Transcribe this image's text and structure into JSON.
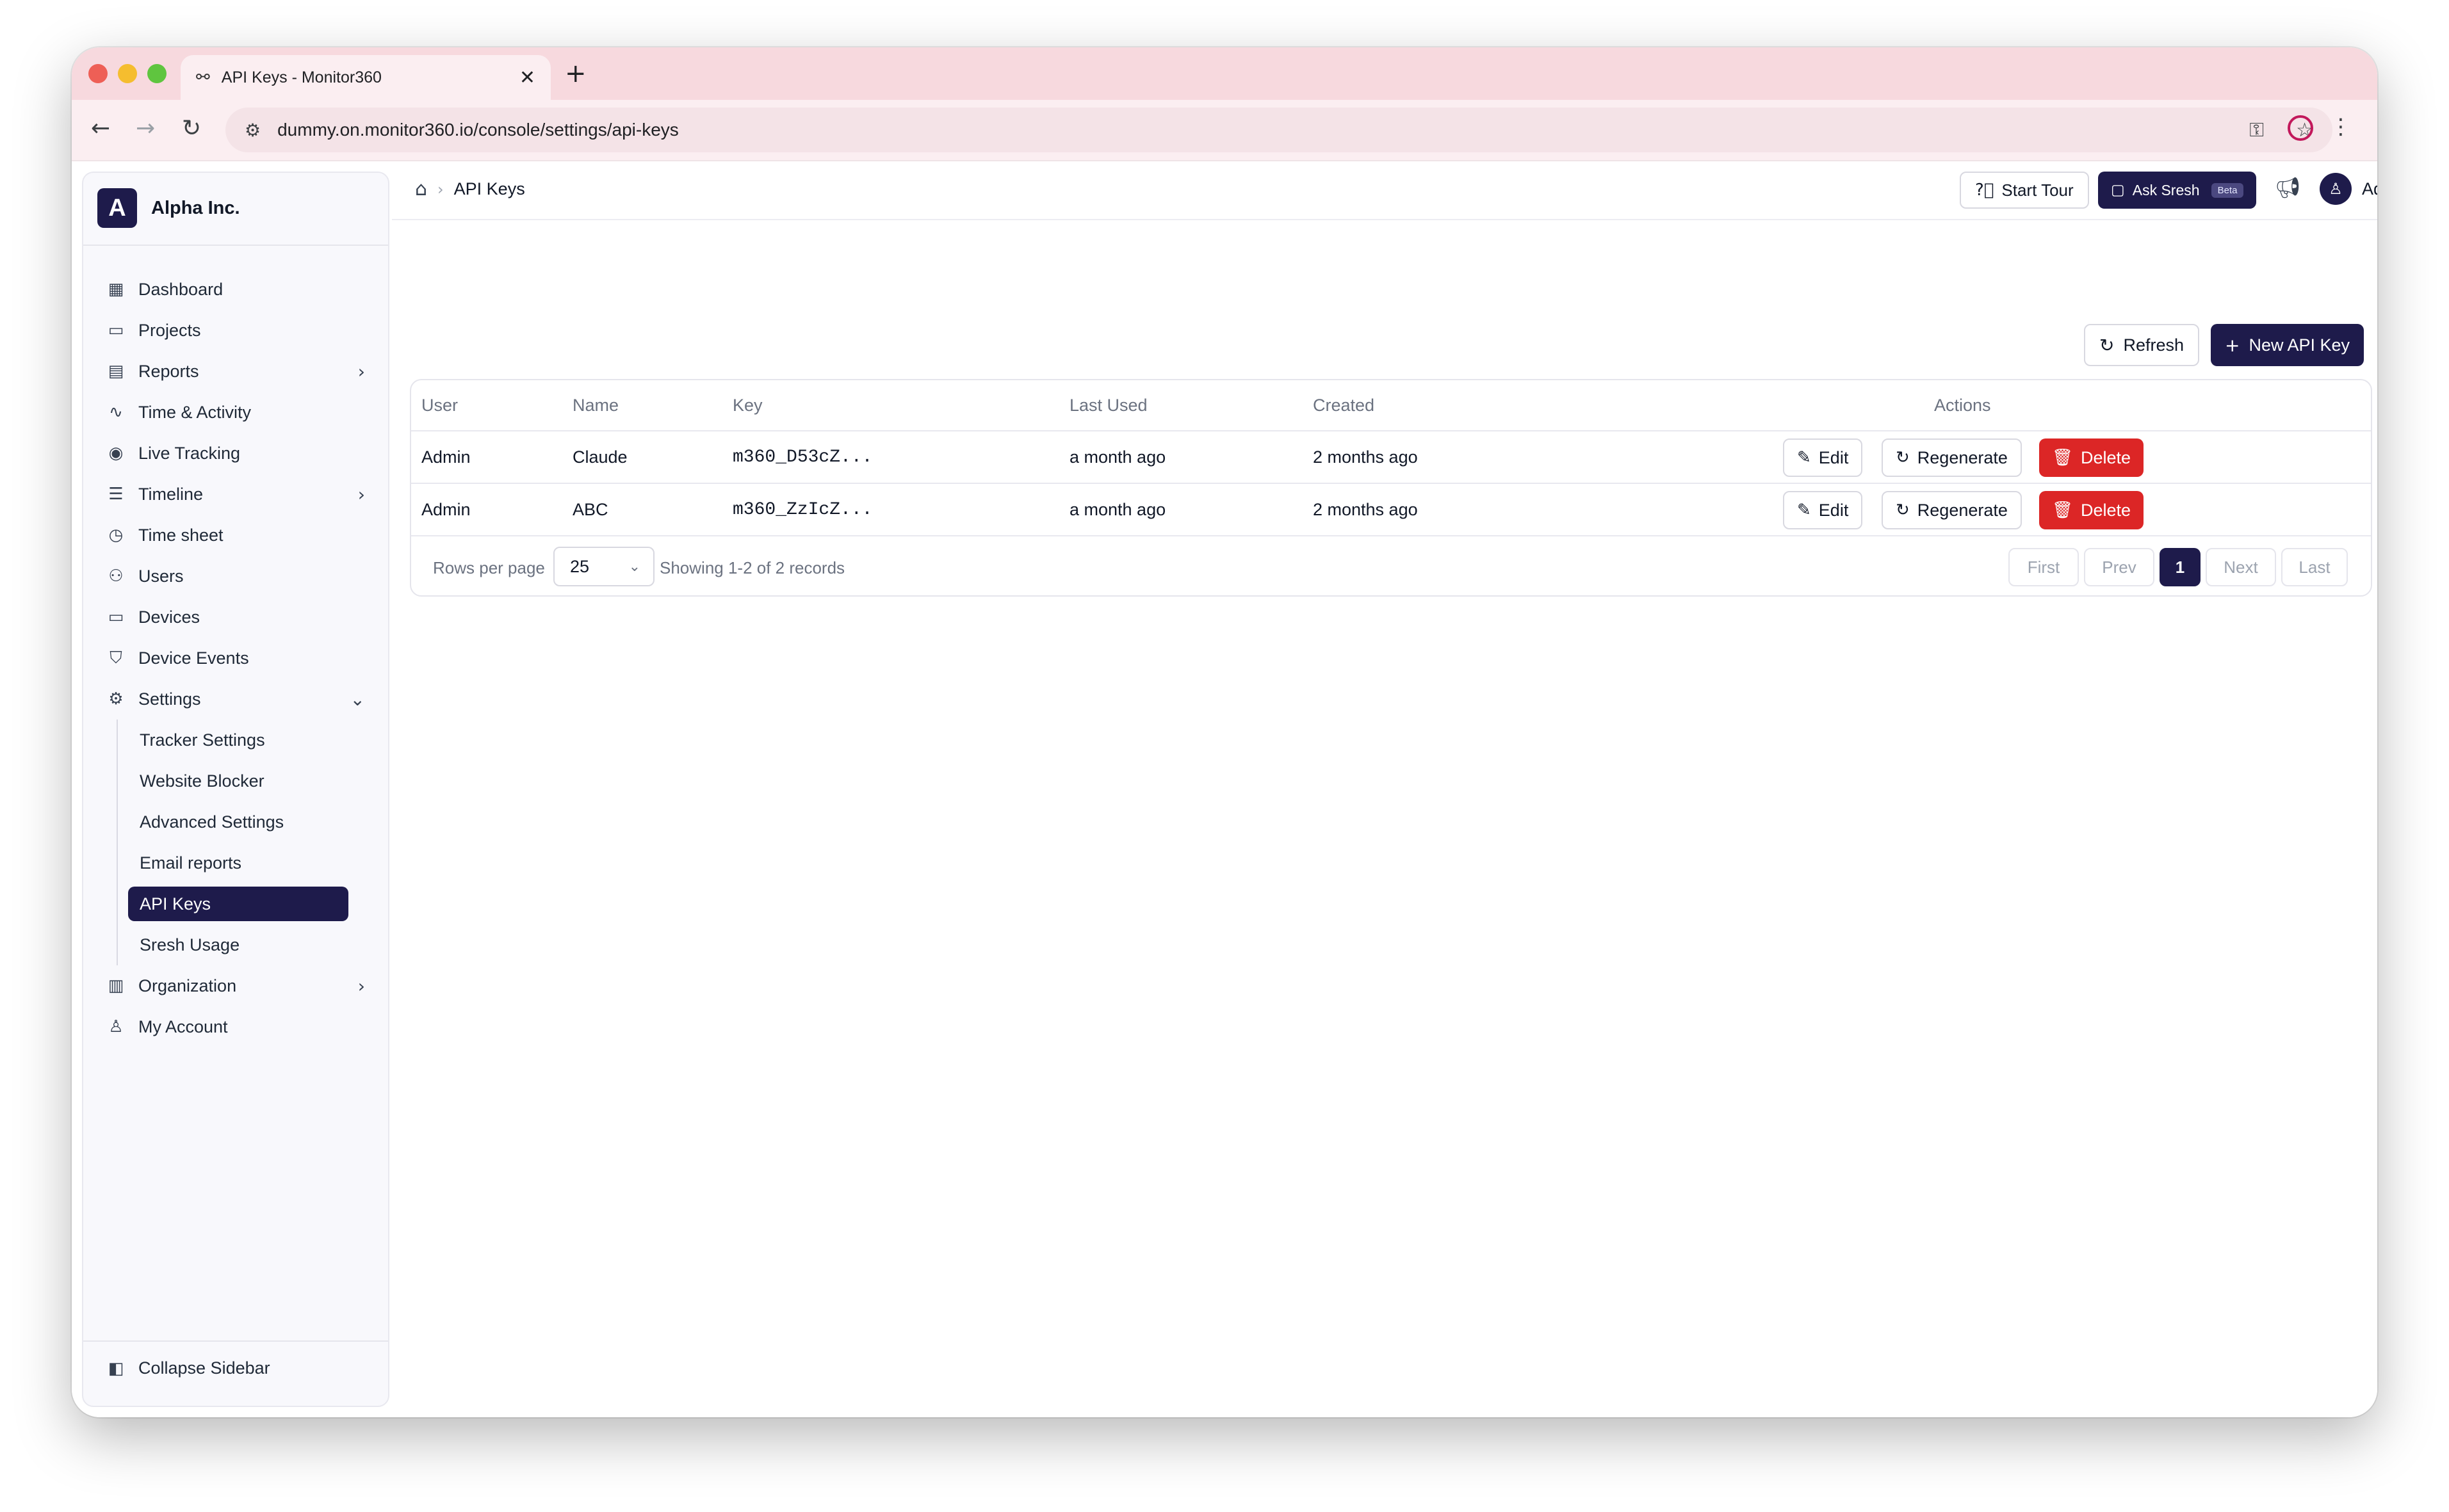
{
  "browser": {
    "tab_title": "API Keys - Monitor360",
    "url": "dummy.on.monitor360.io/console/settings/api-keys",
    "icons": [
      "back-icon",
      "forward-icon",
      "reload-icon",
      "site-info-icon",
      "password-key-icon",
      "bookmark-star-icon",
      "profile-icon",
      "menu-dots-icon"
    ]
  },
  "sidebar": {
    "brand_initial": "A",
    "brand_name": "Alpha Inc.",
    "items": [
      {
        "label": "Dashboard",
        "icon": "dashboard-icon"
      },
      {
        "label": "Projects",
        "icon": "folder-icon"
      },
      {
        "label": "Reports",
        "icon": "report-icon",
        "expandable": true
      },
      {
        "label": "Time & Activity",
        "icon": "activity-icon"
      },
      {
        "label": "Live Tracking",
        "icon": "broadcast-icon"
      },
      {
        "label": "Timeline",
        "icon": "timeline-icon",
        "expandable": true
      },
      {
        "label": "Time sheet",
        "icon": "stopwatch-icon"
      },
      {
        "label": "Users",
        "icon": "users-icon"
      },
      {
        "label": "Devices",
        "icon": "monitor-icon"
      },
      {
        "label": "Device Events",
        "icon": "shield-icon"
      },
      {
        "label": "Settings",
        "icon": "gear-icon",
        "expanded": true
      }
    ],
    "settings_sub": [
      {
        "label": "Tracker Settings"
      },
      {
        "label": "Website Blocker"
      },
      {
        "label": "Advanced Settings"
      },
      {
        "label": "Email reports"
      },
      {
        "label": "API Keys",
        "active": true
      },
      {
        "label": "Sresh Usage"
      }
    ],
    "bottom_items": [
      {
        "label": "Organization",
        "icon": "building-icon",
        "expandable": true
      },
      {
        "label": "My Account",
        "icon": "user-icon"
      }
    ],
    "collapse_label": "Collapse Sidebar"
  },
  "header": {
    "breadcrumb_current": "API Keys",
    "start_tour_label": "Start Tour",
    "ask_sresh_label": "Ask Sresh",
    "beta_badge": "Beta",
    "user_name": "Admin"
  },
  "actions": {
    "refresh_label": "Refresh",
    "new_key_label": "New API Key"
  },
  "table": {
    "columns": [
      "User",
      "Name",
      "Key",
      "Last Used",
      "Created",
      "Actions"
    ],
    "rows": [
      {
        "user": "Admin",
        "name": "Claude",
        "key": "m360_D53cZ...",
        "last_used": "a month ago",
        "created": "2 months ago"
      },
      {
        "user": "Admin",
        "name": "ABC",
        "key": "m360_ZzIcZ...",
        "last_used": "a month ago",
        "created": "2 months ago"
      }
    ],
    "row_actions": {
      "edit": "Edit",
      "regenerate": "Regenerate",
      "delete": "Delete"
    }
  },
  "pagination": {
    "rows_per_page_label": "Rows per page",
    "rows_per_page_value": "25",
    "showing_text": "Showing 1-2 of 2 records",
    "first": "First",
    "prev": "Prev",
    "current_page": "1",
    "next": "Next",
    "last": "Last"
  },
  "colors": {
    "primary": "#1e1b4b",
    "danger": "#dc2626",
    "tabstrip": "#f7d9de"
  }
}
